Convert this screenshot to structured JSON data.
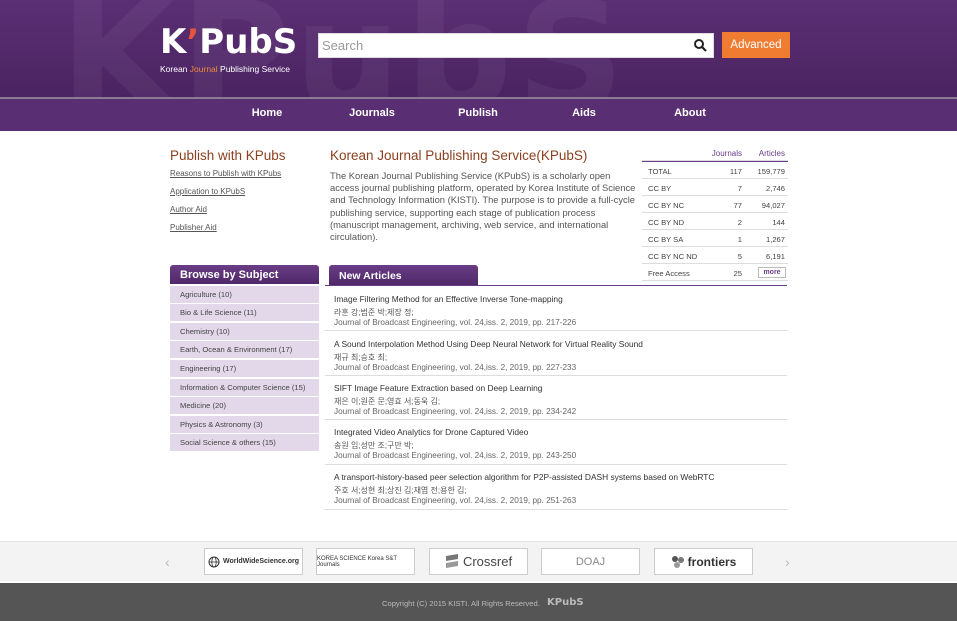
{
  "header": {
    "logo_text": "KPubS",
    "logo_prefix": "K",
    "logo_rest": "PubS",
    "logo_sub_1": "Korean ",
    "logo_sub_hl": "Journal",
    "logo_sub_2": " Publishing Service",
    "search_placeholder": "Search",
    "advanced_label": "Advanced"
  },
  "nav": [
    "Home",
    "Journals",
    "Publish",
    "Aids",
    "About"
  ],
  "publish": {
    "title": "Publish with KPubs",
    "links": [
      "Reasons to Publish with KPubs",
      "Application to KPubS",
      "Author Aid",
      "Publisher Aid"
    ]
  },
  "intro": {
    "title": "Korean Journal Publishing Service(KPubS)",
    "description": "The Korean Journal Publishing Service (KPubS) is a scholarly open access journal publishing platform, operated by Korea Institute of Science and Technology Information (KISTI). The purpose is to provide a full-cycle publishing service, supporting each stage of publication process (manuscript management, archiving, web service, and international circulation)."
  },
  "stats": {
    "col_journals": "Journals",
    "col_articles": "Articles",
    "rows": [
      {
        "name": "TOTAL",
        "journals": "117",
        "articles": "159,779"
      },
      {
        "name": "CC BY",
        "journals": "7",
        "articles": "2,746"
      },
      {
        "name": "CC BY NC",
        "journals": "77",
        "articles": "94,027"
      },
      {
        "name": "CC BY ND",
        "journals": "2",
        "articles": "144"
      },
      {
        "name": "CC BY SA",
        "journals": "1",
        "articles": "1,267"
      },
      {
        "name": "CC BY NC ND",
        "journals": "5",
        "articles": "6,191"
      },
      {
        "name": "Free Access",
        "journals": "25",
        "articles": ""
      }
    ],
    "more_label": "more"
  },
  "browse": {
    "title": "Browse by Subject",
    "items": [
      "Agriculture (10)",
      "Bio & Life Science (11)",
      "Chemistry (10)",
      "Earth, Ocean & Environment (17)",
      "Engineering (17)",
      "Information & Computer Science (15)",
      "Medicine (20)",
      "Physics & Astronomy (3)",
      "Social Science & others (15)"
    ]
  },
  "new_articles": {
    "title": "New Articles",
    "items": [
      {
        "title": "Image Filtering Method for an Effective Inverse Tone-mapping",
        "authors": "라훈 강;범준 박;제장 정;",
        "journal": "Journal of Broadcast Engineering, vol. 24,iss. 2, 2019, pp. 217-226"
      },
      {
        "title": "A Sound Interpolation Method Using Deep Neural Network for Virtual Reality Sound",
        "authors": "재규 최;승호 최;",
        "journal": "Journal of Broadcast Engineering, vol. 24,iss. 2, 2019, pp. 227-233"
      },
      {
        "title": "SIFT Image Feature Extraction based on Deep Learning",
        "authors": "재은 이;원준 문;영효 서;동욱 김;",
        "journal": "Journal of Broadcast Engineering, vol. 24,iss. 2, 2019, pp. 234-242"
      },
      {
        "title": "Integrated Video Analytics for Drone Captured Video",
        "authors": "송원 임;성만 조;구만 박;",
        "journal": "Journal of Broadcast Engineering, vol. 24,iss. 2, 2019, pp. 243-250"
      },
      {
        "title": "A transport-history-based peer selection algorithm for P2P-assisted DASH systems based on WebRTC",
        "authors": "주호 서;성현 최;상진 김;재엽 전;용한 김;",
        "journal": "Journal of Broadcast Engineering, vol. 24,iss. 2, 2019, pp. 251-263"
      }
    ]
  },
  "partners": {
    "prev": "‹",
    "next": "›",
    "items": [
      "WorldWideScience.org",
      "KOREA SCIENCE  Korea S&T Journals",
      "Crossref",
      "DOAJ",
      "frontiers"
    ]
  },
  "footer": {
    "copyright": "Copyright (C) 2015 KISTI. All Rights Reserved.",
    "logo": "KPubS"
  },
  "colors": {
    "brand_purple": "#5a2e72",
    "accent_orange": "#f07c32",
    "title_brown": "#8b3f1e"
  }
}
